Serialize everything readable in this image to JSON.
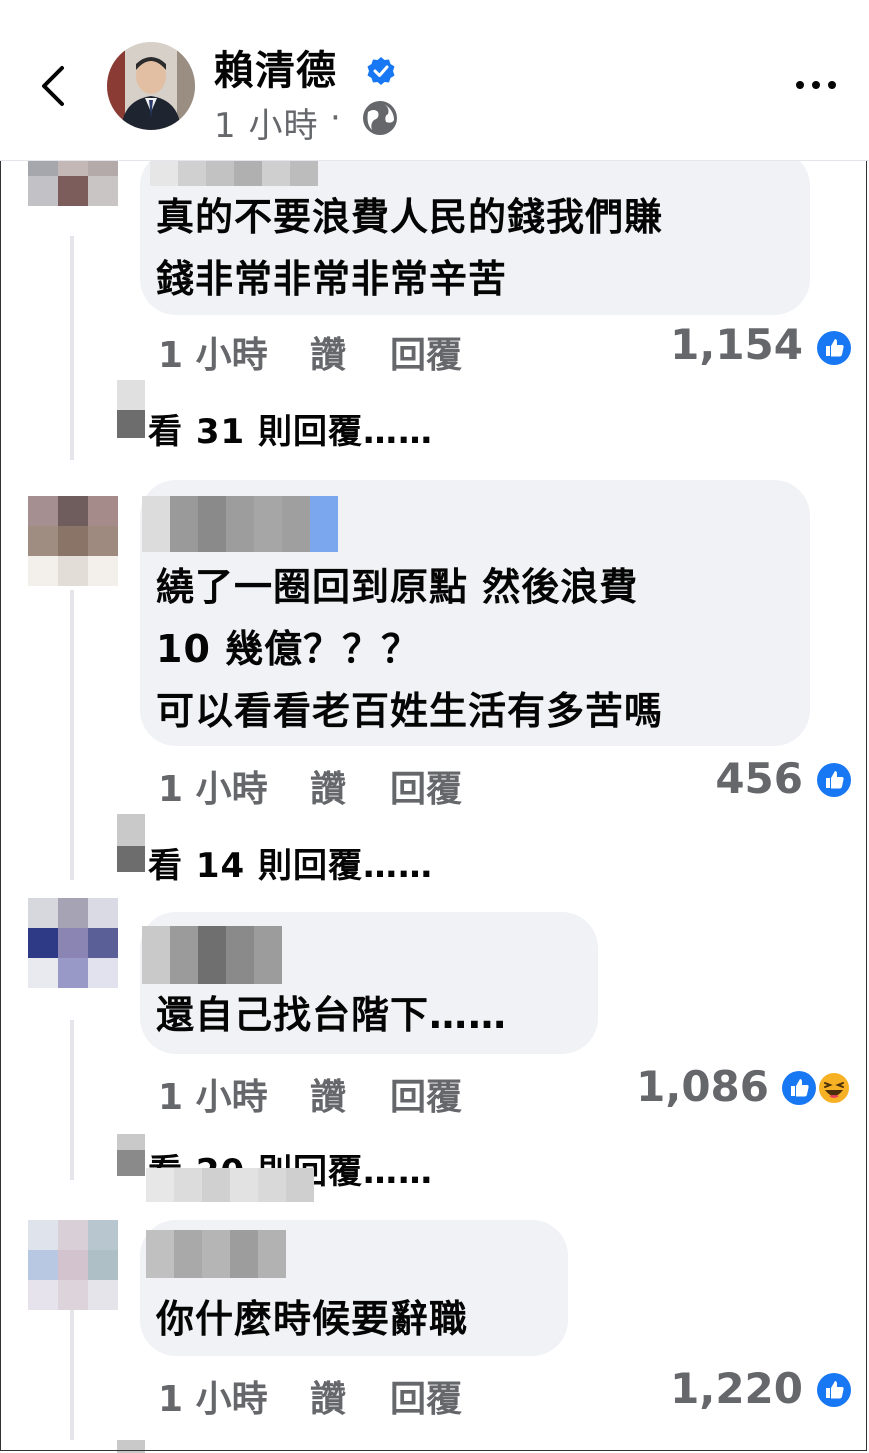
{
  "header": {
    "page_name": "賴清德",
    "post_time": "1 小時",
    "dot": "·"
  },
  "comments": [
    {
      "lines": [
        "真的不要浪費人民的錢我們賺",
        "錢非常非常非常辛苦"
      ],
      "time": "1 小時",
      "like_label": "讚",
      "reply_label": "回覆",
      "reaction_count": "1,154",
      "reactions": [
        "like-icon"
      ],
      "view_replies": "看 31 則回覆……"
    },
    {
      "lines": [
        "繞了一圈回到原點 然後浪費",
        "10 幾億？？？",
        "可以看看老百姓生活有多苦嗎"
      ],
      "time": "1 小時",
      "like_label": "讚",
      "reply_label": "回覆",
      "reaction_count": "456",
      "reactions": [
        "like-icon"
      ],
      "view_replies": "看 14 則回覆……"
    },
    {
      "lines": [
        "還自己找台階下……"
      ],
      "time": "1 小時",
      "like_label": "讚",
      "reply_label": "回覆",
      "reaction_count": "1,086",
      "reactions": [
        "like-icon",
        "haha-icon"
      ],
      "view_replies": "看 20 則回覆……"
    },
    {
      "lines": [
        "你什麼時候要辭職"
      ],
      "time": "1 小時",
      "like_label": "讚",
      "reply_label": "回覆",
      "reaction_count": "1,220",
      "reactions": [
        "like-icon"
      ],
      "view_replies": ""
    }
  ],
  "colors": {
    "verified": "#1877f2",
    "like": "#1877f2",
    "bubble": "#f0f2f5",
    "meta_text": "#65676b"
  }
}
